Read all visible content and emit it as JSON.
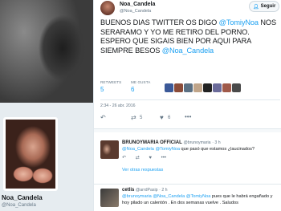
{
  "profile": {
    "name": "Noa_Candela",
    "handle": "@Noa_Candela"
  },
  "tweet": {
    "author_name": "Noa_Candela",
    "author_handle": "@Noa_Candela",
    "follow_label": "Seguir",
    "text_before": "BUENOS DIAS TWITTER OS DIGO ",
    "mention1": "@TomiyNoa",
    "text_middle": " NOS SERARAMO Y YO ME RETIRO DEL PORNO. ESPERO QUE SIGAIS BIEN POR AQUI PARA SIEMPRE BESOS ",
    "mention2": "@Noa_Candela",
    "retweets_label": "RETWEETS",
    "retweets_count": "5",
    "likes_label": "ME GUSTA",
    "likes_count": "6",
    "timestamp": "2:34 - 26 abr. 2016",
    "rt_count": "5",
    "like_count": "6"
  },
  "likers": [
    "#3b5998",
    "#8b4c39",
    "#5b7083",
    "#c0a58a",
    "#222222",
    "#6b6b9a",
    "#a05a4a",
    "#4a4a4a"
  ],
  "replies": [
    {
      "name": "BRUNOYMARIA OFFICIAL",
      "handle": "@brunoymaria",
      "time": "3 h",
      "prefix": "En respuesta a",
      "mention1": "@Noa_Candela",
      "mention2": "@TomiyNoa",
      "text": " que pasó que estamos ¿laucinados?",
      "more": "Ver otras respuestas"
    },
    {
      "name": "cetlis",
      "handle": "@arrdPasip",
      "time": "2 h",
      "mention1": "@brunoymaria",
      "mention2": "@Noa_Candela",
      "mention3": "@TomiyNoa",
      "text": " pues que le habrá engañado y hoy pilado un calentón . En dos semanas vuelve . Saludos"
    }
  ],
  "colors": {
    "accent": "#1da1f2",
    "muted": "#657786",
    "text": "#14171a",
    "border": "#e1e8ed"
  },
  "icons": {
    "reply": "reply-icon",
    "retweet": "retweet-icon",
    "like": "heart-icon",
    "more": "more-icon",
    "follow": "follow-user-icon"
  }
}
